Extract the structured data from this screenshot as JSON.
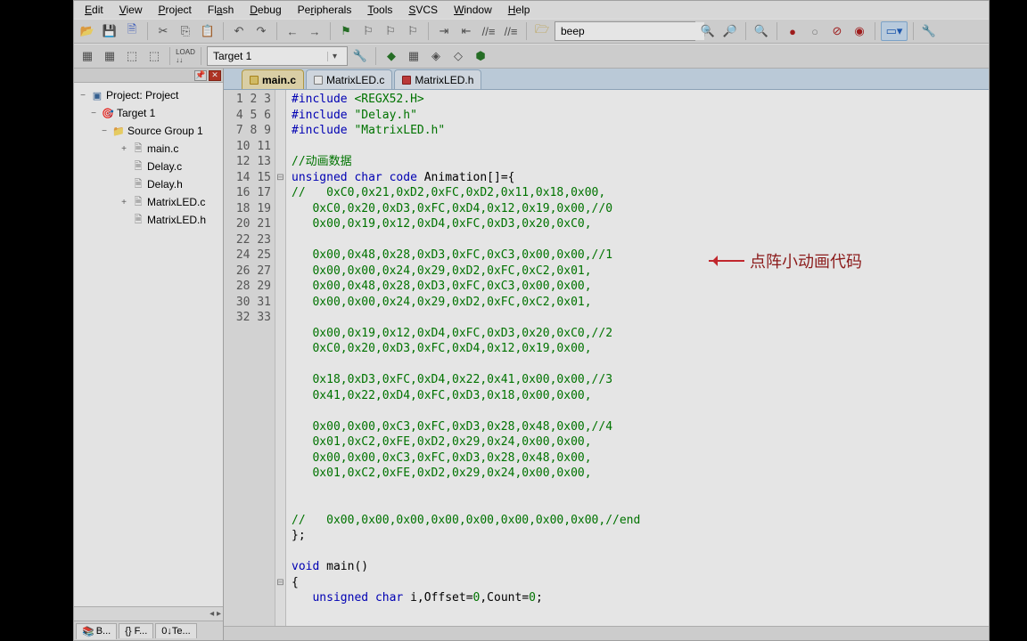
{
  "menu": [
    "Edit",
    "View",
    "Project",
    "Flash",
    "Debug",
    "Peripherals",
    "Tools",
    "SVCS",
    "Window",
    "Help"
  ],
  "toolbar1": {
    "search_value": "beep"
  },
  "toolbar2": {
    "target_value": "Target 1"
  },
  "sidebar": {
    "root": "Project: Project",
    "target": "Target 1",
    "group": "Source Group 1",
    "files": [
      "main.c",
      "Delay.c",
      "Delay.h",
      "MatrixLED.c",
      "MatrixLED.h"
    ],
    "tabs": [
      "B...",
      "{} F...",
      "0↓Te..."
    ]
  },
  "tabs": [
    {
      "label": "main.c",
      "color": "y",
      "active": true
    },
    {
      "label": "MatrixLED.c",
      "color": "g",
      "active": false
    },
    {
      "label": "MatrixLED.h",
      "color": "r",
      "active": false
    }
  ],
  "code_lines": [
    {
      "n": 1,
      "fold": "",
      "html": "<span class='kw'>#include</span> <span class='str'>&lt;REGX52.H&gt;</span>"
    },
    {
      "n": 2,
      "fold": "",
      "html": "<span class='kw'>#include</span> <span class='str'>\"Delay.h\"</span>"
    },
    {
      "n": 3,
      "fold": "",
      "html": "<span class='kw'>#include</span> <span class='str'>\"MatrixLED.h\"</span>"
    },
    {
      "n": 4,
      "fold": "",
      "html": ""
    },
    {
      "n": 5,
      "fold": "",
      "html": "<span class='cmt'>//动画数据</span>"
    },
    {
      "n": 6,
      "fold": "⊟",
      "html": "<span class='kw'>unsigned</span> <span class='kw'>char</span> <span class='code-type'>code</span> Animation[]={"
    },
    {
      "n": 7,
      "fold": " ",
      "html": "<span class='cmt'>//   0xC0,0x21,0xD2,0xFC,0xD2,0x11,0x18,0x00,</span>"
    },
    {
      "n": 8,
      "fold": " ",
      "html": "<span class='num'>   0xC0,0x20,0xD3,0xFC,0xD4,0x12,0x19,0x00,</span><span class='cmt'>//0</span>"
    },
    {
      "n": 9,
      "fold": " ",
      "html": "<span class='num'>   0x00,0x19,0x12,0xD4,0xFC,0xD3,0x20,0xC0,</span>"
    },
    {
      "n": 10,
      "fold": " ",
      "html": ""
    },
    {
      "n": 11,
      "fold": " ",
      "html": "<span class='num'>   0x00,0x48,0x28,0xD3,0xFC,0xC3,0x00,0x00,</span><span class='cmt'>//1</span>"
    },
    {
      "n": 12,
      "fold": " ",
      "html": "<span class='num'>   0x00,0x00,0x24,0x29,0xD2,0xFC,0xC2,0x01,</span>"
    },
    {
      "n": 13,
      "fold": " ",
      "html": "<span class='num'>   0x00,0x48,0x28,0xD3,0xFC,0xC3,0x00,0x00,</span>"
    },
    {
      "n": 14,
      "fold": " ",
      "html": "<span class='num'>   0x00,0x00,0x24,0x29,0xD2,0xFC,0xC2,0x01,</span>"
    },
    {
      "n": 15,
      "fold": " ",
      "html": ""
    },
    {
      "n": 16,
      "fold": " ",
      "html": "<span class='num'>   0x00,0x19,0x12,0xD4,0xFC,0xD3,0x20,0xC0,</span><span class='cmt'>//2</span>"
    },
    {
      "n": 17,
      "fold": " ",
      "html": "<span class='num'>   0xC0,0x20,0xD3,0xFC,0xD4,0x12,0x19,0x00,</span>"
    },
    {
      "n": 18,
      "fold": " ",
      "html": ""
    },
    {
      "n": 19,
      "fold": " ",
      "html": "<span class='num'>   0x18,0xD3,0xFC,0xD4,0x22,0x41,0x00,0x00,</span><span class='cmt'>//3</span>"
    },
    {
      "n": 20,
      "fold": " ",
      "html": "<span class='num'>   0x41,0x22,0xD4,0xFC,0xD3,0x18,0x00,0x00,</span>"
    },
    {
      "n": 21,
      "fold": " ",
      "html": ""
    },
    {
      "n": 22,
      "fold": " ",
      "html": "<span class='num'>   0x00,0x00,0xC3,0xFC,0xD3,0x28,0x48,0x00,</span><span class='cmt'>//4</span>"
    },
    {
      "n": 23,
      "fold": " ",
      "html": "<span class='num'>   0x01,0xC2,0xFE,0xD2,0x29,0x24,0x00,0x00,</span>"
    },
    {
      "n": 24,
      "fold": " ",
      "html": "<span class='num'>   0x00,0x00,0xC3,0xFC,0xD3,0x28,0x48,0x00,</span>"
    },
    {
      "n": 25,
      "fold": " ",
      "html": "<span class='num'>   0x01,0xC2,0xFE,0xD2,0x29,0x24,0x00,0x00,</span>"
    },
    {
      "n": 26,
      "fold": " ",
      "html": ""
    },
    {
      "n": 27,
      "fold": " ",
      "html": ""
    },
    {
      "n": 28,
      "fold": " ",
      "html": "<span class='cmt'>//   0x00,0x00,0x00,0x00,0x00,0x00,0x00,0x00,//end</span>"
    },
    {
      "n": 29,
      "fold": " ",
      "html": "};"
    },
    {
      "n": 30,
      "fold": "",
      "html": ""
    },
    {
      "n": 31,
      "fold": "",
      "html": "<span class='kw'>void</span> main()"
    },
    {
      "n": 32,
      "fold": "⊟",
      "html": "{"
    },
    {
      "n": 33,
      "fold": " ",
      "html": "   <span class='kw'>unsigned</span> <span class='kw'>char</span> i,Offset=<span class='num'>0</span>,Count=<span class='num'>0</span>;"
    }
  ],
  "annotation": "点阵小动画代码"
}
